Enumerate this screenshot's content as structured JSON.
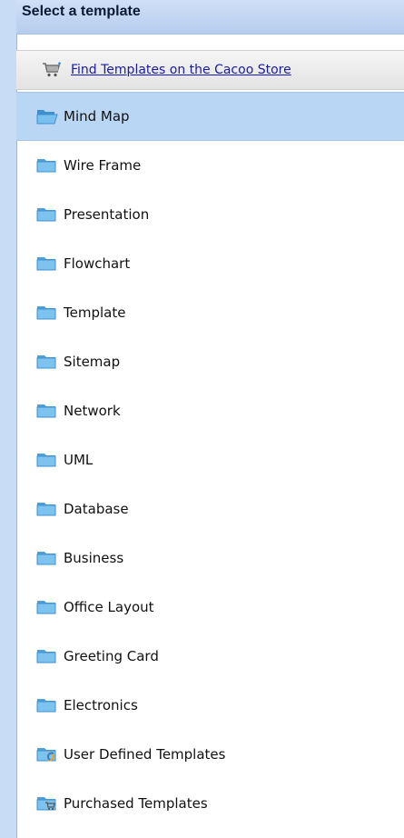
{
  "header": {
    "title": "Select a template"
  },
  "store": {
    "label": "Find Templates on the Cacoo Store",
    "icon": "cart-icon"
  },
  "templates": [
    {
      "label": "Mind Map",
      "icon": "folder-open-icon",
      "selected": true
    },
    {
      "label": "Wire Frame",
      "icon": "folder-icon"
    },
    {
      "label": "Presentation",
      "icon": "folder-icon"
    },
    {
      "label": "Flowchart",
      "icon": "folder-icon"
    },
    {
      "label": "Template",
      "icon": "folder-icon"
    },
    {
      "label": "Sitemap",
      "icon": "folder-icon"
    },
    {
      "label": "Network",
      "icon": "folder-icon"
    },
    {
      "label": "UML",
      "icon": "folder-icon"
    },
    {
      "label": "Database",
      "icon": "folder-icon"
    },
    {
      "label": "Business",
      "icon": "folder-icon"
    },
    {
      "label": "Office Layout",
      "icon": "folder-icon"
    },
    {
      "label": "Greeting Card",
      "icon": "folder-icon"
    },
    {
      "label": "Electronics",
      "icon": "folder-icon"
    },
    {
      "label": "User Defined Templates",
      "icon": "folder-user-icon"
    },
    {
      "label": "Purchased Templates",
      "icon": "folder-cart-icon"
    }
  ],
  "colors": {
    "selected_bg": "#b9d7f5",
    "link": "#1a1aa8",
    "folder": "#5fb2e8"
  }
}
